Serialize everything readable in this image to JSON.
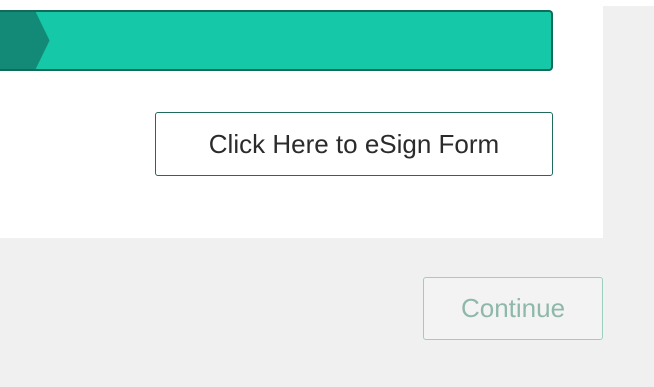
{
  "progress": {
    "value_fraction": 0.09,
    "track_color": "#15c9a8",
    "fill_color": "#138a78",
    "border_color": "#0f6b5a"
  },
  "actions": {
    "esign_label": "Click Here to eSign Form",
    "continue_label": "Continue"
  },
  "colors": {
    "page_background": "#f0f0f0",
    "card_background": "#ffffff",
    "button_border": "#1f6b5c",
    "disabled_text": "#8fb8ab",
    "disabled_border": "#9ccfc0"
  }
}
